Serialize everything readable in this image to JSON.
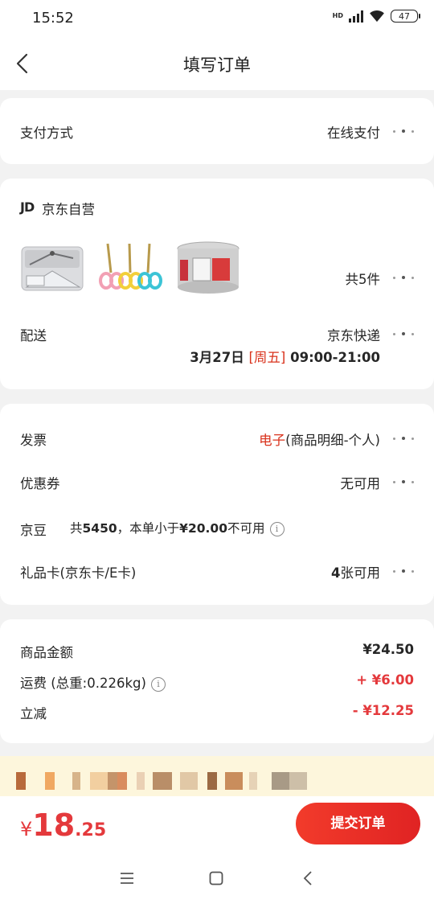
{
  "status_bar": {
    "time": "15:52",
    "network": "HD",
    "battery": "47"
  },
  "nav": {
    "title": "填写订单"
  },
  "payment": {
    "label": "支付方式",
    "value": "在线支付"
  },
  "store": {
    "logo": "JD",
    "name": "京东自营",
    "items_count": "共5件",
    "delivery_label": "配送",
    "delivery_value": "京东快递",
    "delivery_date": "3月27日",
    "delivery_weekday": "[周五]",
    "delivery_time": "09:00-21:00"
  },
  "options": {
    "invoice_label": "发票",
    "invoice_type": "电子",
    "invoice_detail": "(商品明细-个人)",
    "coupon_label": "优惠券",
    "coupon_value": "无可用",
    "jingdou_label": "京豆",
    "jingdou_prefix": "共",
    "jingdou_count": "5450",
    "jingdou_mid": "，本单小于",
    "jingdou_amount": "¥20.00",
    "jingdou_suffix": "不可用",
    "giftcard_label": "礼品卡(京东卡/E卡)",
    "giftcard_count": "4",
    "giftcard_suffix": "张可用"
  },
  "summary": {
    "goods_label": "商品金额",
    "goods_value": "¥24.50",
    "shipping_label": "运费",
    "shipping_weight": "(总重:0.226kg)",
    "shipping_value": "+ ¥6.00",
    "discount_label": "立减",
    "discount_value": "- ¥12.25"
  },
  "footer": {
    "currency": "¥",
    "total_int": "18",
    "total_dec": ".25",
    "submit_label": "提交订单"
  },
  "colors": {
    "accent": "#e4393c",
    "background": "#f2f2f2",
    "promo": "#fdf6dc"
  }
}
